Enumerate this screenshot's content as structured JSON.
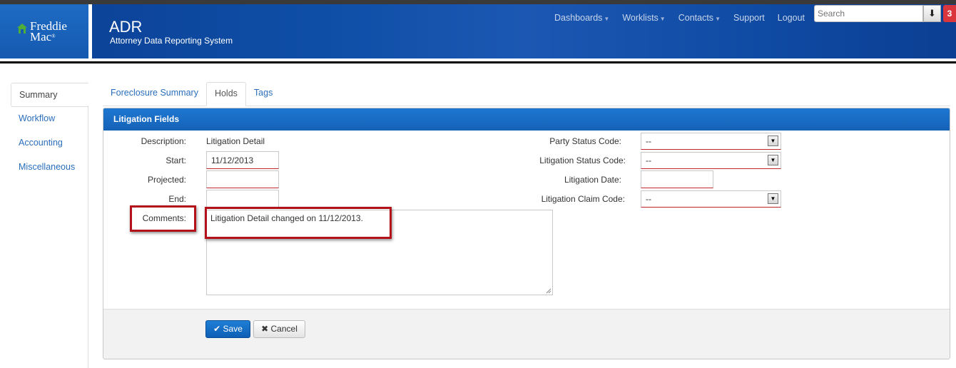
{
  "header": {
    "logo_line1": "Freddie",
    "logo_line2": "Mac",
    "logo_mark": "®",
    "app_title": "ADR",
    "app_subtitle": "Attorney Data Reporting System",
    "nav": [
      {
        "label": "Dashboards",
        "dropdown": true
      },
      {
        "label": "Worklists",
        "dropdown": true
      },
      {
        "label": "Contacts",
        "dropdown": true
      },
      {
        "label": "Support",
        "dropdown": false
      },
      {
        "label": "Logout",
        "dropdown": false
      }
    ],
    "search_placeholder": "Search",
    "search_button_icon": "download-arrow-icon",
    "notification_count": "3"
  },
  "sidebar": {
    "items": [
      {
        "label": "Summary",
        "active": true
      },
      {
        "label": "Workflow",
        "active": false
      },
      {
        "label": "Accounting",
        "active": false
      },
      {
        "label": "Miscellaneous",
        "active": false
      }
    ]
  },
  "tabs": [
    {
      "label": "Foreclosure Summary",
      "active": false
    },
    {
      "label": "Holds",
      "active": true
    },
    {
      "label": "Tags",
      "active": false
    }
  ],
  "panel": {
    "title": "Litigation Fields",
    "left": {
      "description_label": "Description:",
      "description_value": "Litigation Detail",
      "start_label": "Start:",
      "start_value": "11/12/2013",
      "projected_label": "Projected:",
      "projected_value": "",
      "end_label": "End:",
      "end_value": "",
      "comments_label": "Comments:",
      "comments_value": "Litigation Detail changed on 11/12/2013."
    },
    "right": {
      "party_status_label": "Party Status Code:",
      "party_status_value": "--",
      "litigation_status_label": "Litigation Status Code:",
      "litigation_status_value": "--",
      "litigation_date_label": "Litigation Date:",
      "litigation_date_value": "",
      "claim_code_label": "Litigation Claim Code:",
      "claim_code_value": "--"
    },
    "save_label": "Save",
    "cancel_label": "Cancel"
  },
  "colors": {
    "header_blue": "#0f4fa8",
    "panel_blue": "#1a6cc4",
    "link_blue": "#2a6ebb",
    "annotation_red": "#b3121b",
    "badge_red": "#d9363e"
  }
}
